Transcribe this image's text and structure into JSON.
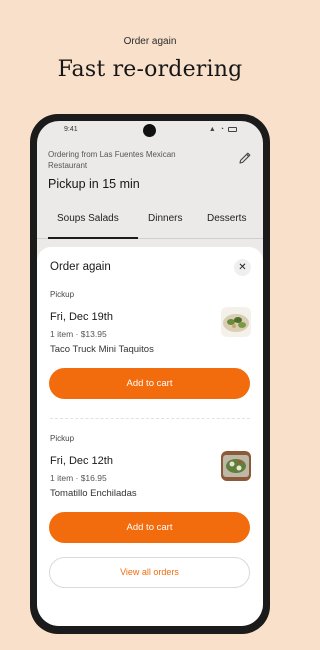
{
  "promo": {
    "eyebrow": "Order again",
    "title": "Fast re-ordering"
  },
  "status_bar": {
    "time": "9:41"
  },
  "header": {
    "ordering_from": "Ordering from Las Fuentes Mexican Restaurant",
    "pickup_time": "Pickup in 15 min",
    "edit_icon": "pencil-icon"
  },
  "tabs": [
    {
      "label": "Soups Salads",
      "active": true
    },
    {
      "label": "Dinners",
      "active": false
    },
    {
      "label": "Desserts",
      "active": false
    }
  ],
  "sheet": {
    "title": "Order again",
    "close_icon": "close-icon",
    "orders": [
      {
        "type": "Pickup",
        "date": "Fri, Dec 19th",
        "meta": "1 item · $13.95",
        "item": "Taco Truck Mini Taquitos",
        "button": "Add to cart"
      },
      {
        "type": "Pickup",
        "date": "Fri, Dec 12th",
        "meta": "1 item · $16.95",
        "item": "Tomatillo Enchiladas",
        "button": "Add to cart"
      }
    ],
    "view_all": "View all orders"
  },
  "colors": {
    "background": "#f9e0cb",
    "accent": "#f26c0d"
  }
}
